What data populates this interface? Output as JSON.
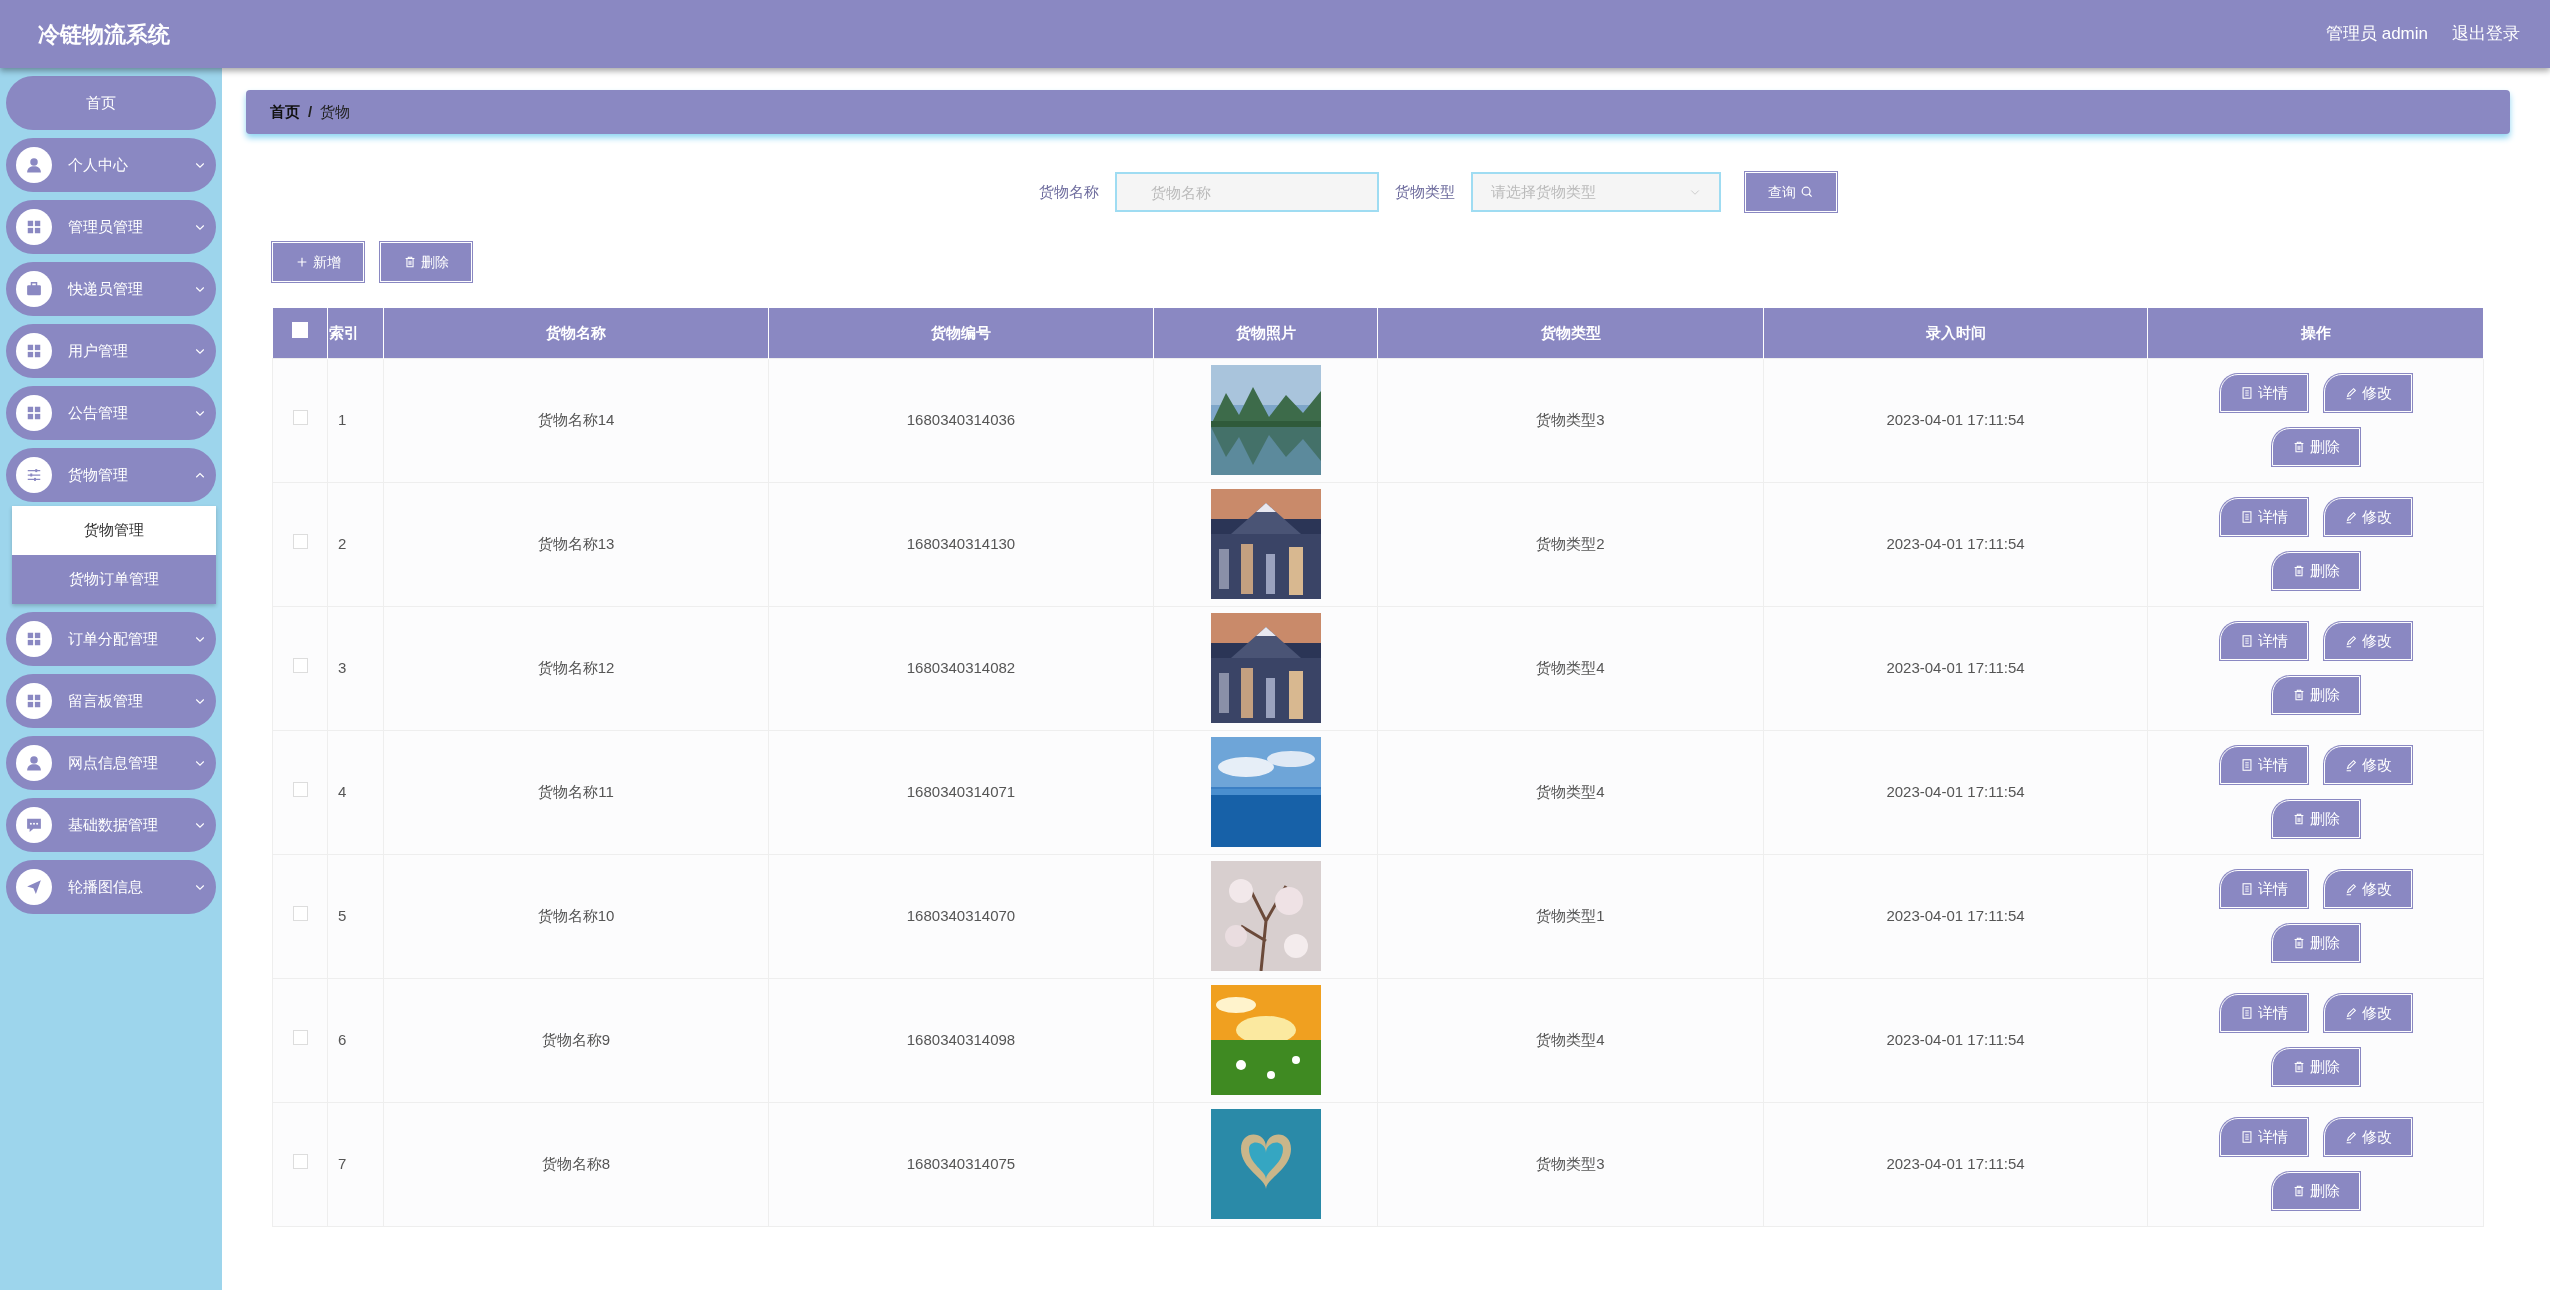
{
  "app_title": "冷链物流系统",
  "header": {
    "user": "管理员 admin",
    "logout": "退出登录"
  },
  "sidebar": {
    "items": [
      {
        "label": "首页",
        "kind": "link"
      },
      {
        "label": "个人中心",
        "kind": "menu",
        "expanded": false
      },
      {
        "label": "管理员管理",
        "kind": "menu",
        "expanded": false
      },
      {
        "label": "快递员管理",
        "kind": "menu",
        "expanded": false
      },
      {
        "label": "用户管理",
        "kind": "menu",
        "expanded": false
      },
      {
        "label": "公告管理",
        "kind": "menu",
        "expanded": false
      },
      {
        "label": "货物管理",
        "kind": "menu",
        "expanded": true,
        "children": [
          {
            "label": "货物管理",
            "selected": true
          },
          {
            "label": "货物订单管理",
            "selected": false
          }
        ]
      },
      {
        "label": "订单分配管理",
        "kind": "menu",
        "expanded": false
      },
      {
        "label": "留言板管理",
        "kind": "menu",
        "expanded": false
      },
      {
        "label": "网点信息管理",
        "kind": "menu",
        "expanded": false
      },
      {
        "label": "基础数据管理",
        "kind": "menu",
        "expanded": false
      },
      {
        "label": "轮播图信息",
        "kind": "menu",
        "expanded": false
      }
    ]
  },
  "breadcrumb": {
    "items": [
      "首页",
      "货物"
    ],
    "separator": "/"
  },
  "search": {
    "fields": [
      {
        "label": "货物名称",
        "kind": "text",
        "placeholder": "货物名称"
      },
      {
        "label": "货物类型",
        "kind": "select",
        "placeholder": "请选择货物类型"
      }
    ],
    "button": "查询"
  },
  "actions": [
    {
      "label": "新增",
      "kind": "add"
    },
    {
      "label": "删除",
      "kind": "delete"
    }
  ],
  "table": {
    "select_all_checked": false,
    "columns": [
      "索引",
      "货物名称",
      "货物编号",
      "货物照片",
      "货物类型",
      "录入时间",
      "操作"
    ],
    "rows": [
      {
        "checked": false,
        "index": "1",
        "name": "货物名称14",
        "code": "1680340314036",
        "type": "货物类型3",
        "time": "2023-04-01 17:11:54",
        "actions": [
          {
            "label": "详情",
            "kind": "detail"
          },
          {
            "label": "修改",
            "kind": "edit"
          },
          {
            "label": "删除",
            "kind": "delete"
          }
        ]
      },
      {
        "checked": false,
        "index": "2",
        "name": "货物名称13",
        "code": "1680340314130",
        "type": "货物类型2",
        "time": "2023-04-01 17:11:54",
        "actions": [
          {
            "label": "详情",
            "kind": "detail"
          },
          {
            "label": "修改",
            "kind": "edit"
          },
          {
            "label": "删除",
            "kind": "delete"
          }
        ]
      },
      {
        "checked": false,
        "index": "3",
        "name": "货物名称12",
        "code": "1680340314082",
        "type": "货物类型4",
        "time": "2023-04-01 17:11:54",
        "actions": [
          {
            "label": "详情",
            "kind": "detail"
          },
          {
            "label": "修改",
            "kind": "edit"
          },
          {
            "label": "删除",
            "kind": "delete"
          }
        ]
      },
      {
        "checked": false,
        "index": "4",
        "name": "货物名称11",
        "code": "1680340314071",
        "type": "货物类型4",
        "time": "2023-04-01 17:11:54",
        "actions": [
          {
            "label": "详情",
            "kind": "detail"
          },
          {
            "label": "修改",
            "kind": "edit"
          },
          {
            "label": "删除",
            "kind": "delete"
          }
        ]
      },
      {
        "checked": false,
        "index": "5",
        "name": "货物名称10",
        "code": "1680340314070",
        "type": "货物类型1",
        "time": "2023-04-01 17:11:54",
        "actions": [
          {
            "label": "详情",
            "kind": "detail"
          },
          {
            "label": "修改",
            "kind": "edit"
          },
          {
            "label": "删除",
            "kind": "delete"
          }
        ]
      },
      {
        "checked": false,
        "index": "6",
        "name": "货物名称9",
        "code": "1680340314098",
        "type": "货物类型4",
        "time": "2023-04-01 17:11:54",
        "actions": [
          {
            "label": "详情",
            "kind": "detail"
          },
          {
            "label": "修改",
            "kind": "edit"
          },
          {
            "label": "删除",
            "kind": "delete"
          }
        ]
      },
      {
        "checked": false,
        "index": "7",
        "name": "货物名称8",
        "code": "1680340314075",
        "type": "货物类型3",
        "time": "2023-04-01 17:11:54",
        "actions": [
          {
            "label": "详情",
            "kind": "detail"
          },
          {
            "label": "修改",
            "kind": "edit"
          },
          {
            "label": "删除",
            "kind": "delete"
          }
        ]
      }
    ]
  }
}
